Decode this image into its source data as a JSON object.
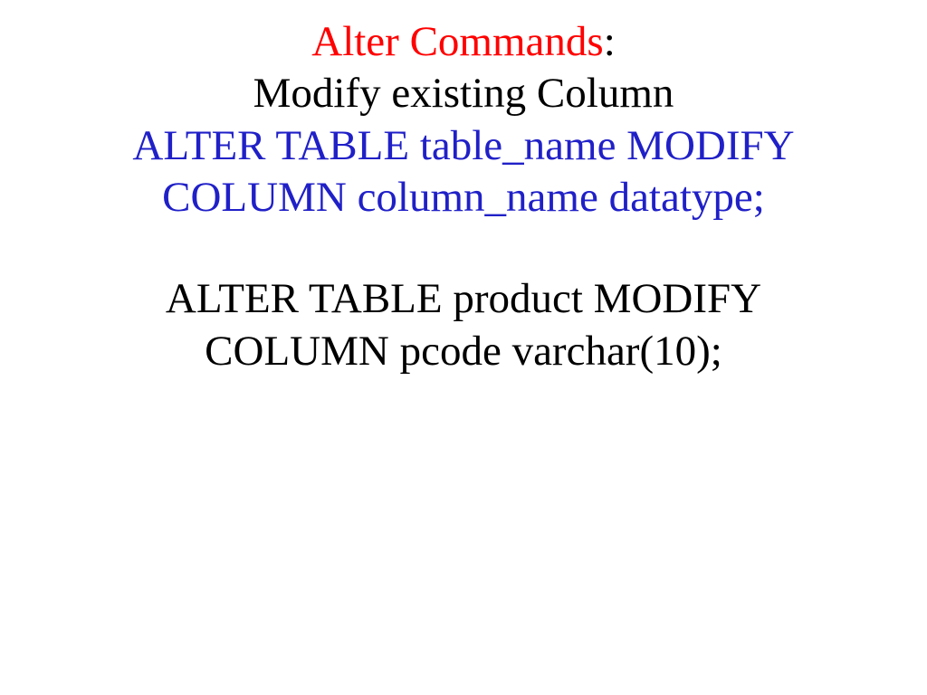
{
  "heading": {
    "title": "Alter Commands",
    "colon": ":"
  },
  "subtitle": "Modify existing Column",
  "syntax": {
    "line1": "ALTER TABLE table_name MODIFY",
    "line2": "COLUMN column_name datatype;"
  },
  "example": {
    "line1": "ALTER TABLE product MODIFY",
    "line2": "COLUMN pcode varchar(10);"
  }
}
